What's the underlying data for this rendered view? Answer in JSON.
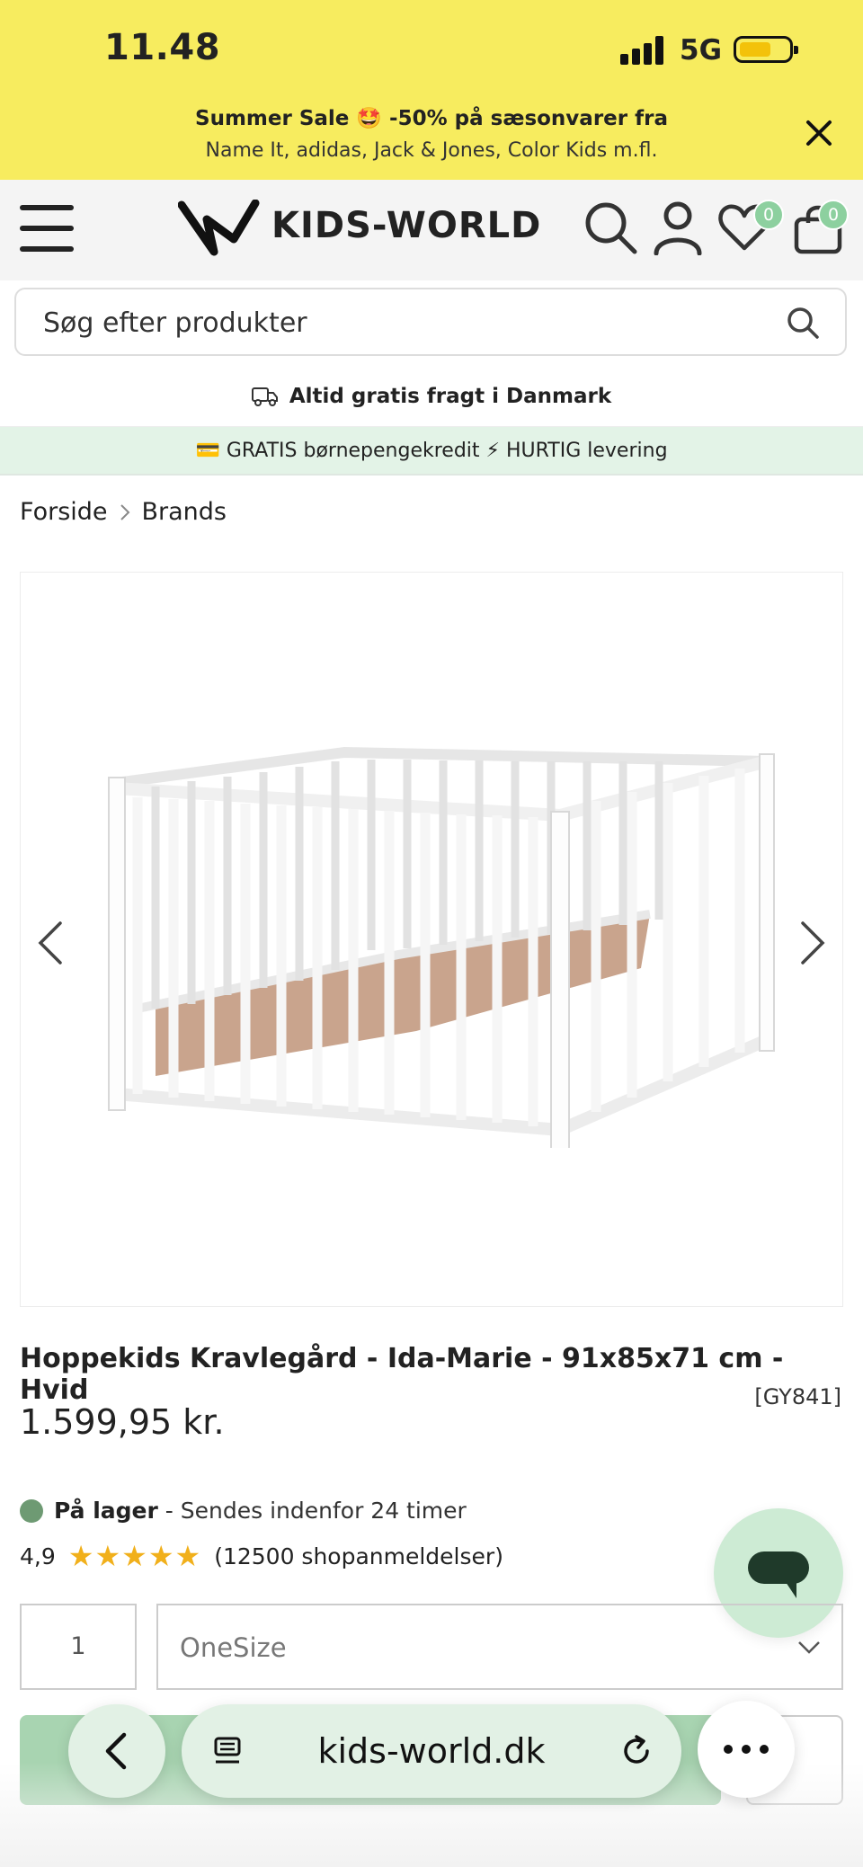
{
  "status_bar": {
    "time": "11.48",
    "network": "5G"
  },
  "promo": {
    "line1": "Summer Sale 🤩 -50% på sæsonvarer fra",
    "line2": "Name It, adidas, Jack & Jones, Color Kids m.fl."
  },
  "header": {
    "logo_text": "KIDS-WORLD",
    "wishlist_count": "0",
    "cart_count": "0"
  },
  "search": {
    "placeholder": "Søg efter produkter"
  },
  "shipping": {
    "text": "Altid gratis fragt i Danmark"
  },
  "benefits": {
    "text": "💳 GRATIS børnepengekredit ⚡ HURTIG levering"
  },
  "breadcrumb": {
    "items": [
      "Forside",
      "Brands"
    ]
  },
  "product": {
    "title": "Hoppekids Kravlegård - Ida-Marie - 91x85x71 cm - Hvid",
    "sku": "[GY841]",
    "price": "1.599,95 kr.",
    "stock_label": "På lager",
    "stock_detail": " - Sendes indenfor 24 timer",
    "rating": "4,9",
    "stars": "★★★★★",
    "reviews": "(12500 shopanmeldelser)",
    "quantity": "1",
    "size": "OneSize"
  },
  "browser": {
    "url": "kids-world.dk"
  },
  "colors": {
    "promo_bg": "#f7ec5f",
    "accent_green": "#a8d4b1",
    "badge_green": "#8dd09f",
    "star": "#f1b01b"
  }
}
